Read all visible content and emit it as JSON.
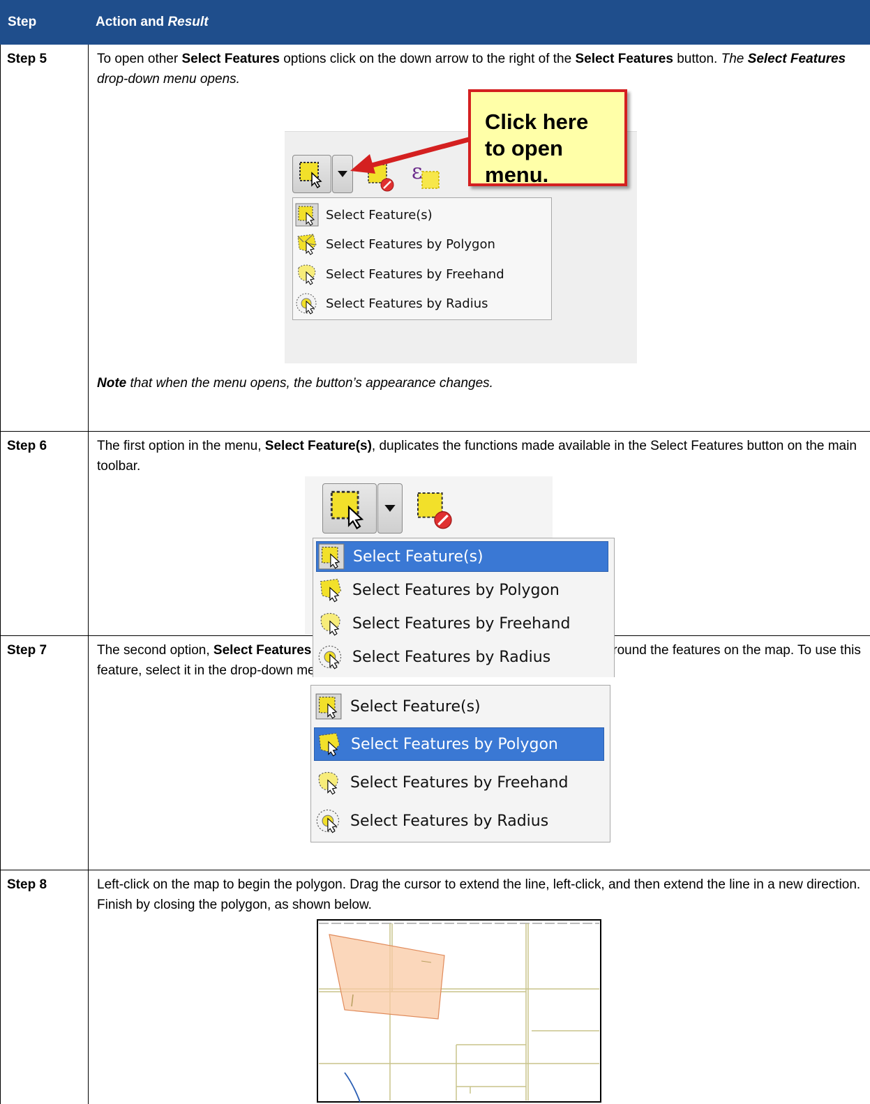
{
  "header": {
    "col_step": "Step",
    "col_action_plain": "Action and ",
    "col_action_italic": "Result"
  },
  "rows": [
    {
      "step": "Step 5",
      "text": {
        "t1": "To open other ",
        "b1": "Select Features",
        "t2": " options click on the down arrow to the right of the ",
        "b2": "Select Features",
        "t3": " button. ",
        "i1": "The ",
        "ib1": "Select Features",
        "i2": " drop-down menu opens."
      },
      "callout": "Click here to open menu.",
      "menu": [
        "Select Feature(s)",
        "Select Features by Polygon",
        "Select Features by Freehand",
        "Select Features by Radius"
      ],
      "note_bold": "Note",
      "note_rest": " that when the menu opens, the button’s appearance changes."
    },
    {
      "step": "Step 6",
      "text": {
        "t1": "The first option in the menu, ",
        "b1": "Select Feature(s)",
        "t2": ", duplicates the functions made available in the Select Features button on the main toolbar."
      },
      "menu": [
        "Select Feature(s)",
        "Select Features by Polygon",
        "Select Features by Freehand",
        "Select Features by Radius"
      ],
      "selected_index": 0
    },
    {
      "step": "Step 7",
      "text": {
        "t1": "The second option, ",
        "b1": "Select Features by Polygon",
        "t2": ", select features via a polygon drawn around the features on the map. To use this feature, select it in the drop-down menu then follow the steps below."
      },
      "menu": [
        "Select Feature(s)",
        "Select Features by Polygon",
        "Select Features by Freehand",
        "Select Features by Radius"
      ],
      "selected_index": 1
    },
    {
      "step": "Step 8",
      "text": {
        "t1": "Left-click on the map to begin the polygon. Drag the cursor to extend the line, left-click, and then extend the line in a new direction. Finish by closing the polygon, as shown below."
      }
    }
  ],
  "colors": {
    "header_bg": "#1f4e8c",
    "menu_selected": "#3a78d4",
    "callout_fill": "#ffffa8",
    "callout_border": "#d42020",
    "polygon_fill": "#f9c9a4"
  },
  "icons": [
    "select-feature-icon",
    "select-polygon-icon",
    "select-freehand-icon",
    "select-radius-icon",
    "deselect-icon",
    "expression-select-icon",
    "dropdown-arrow-icon"
  ]
}
